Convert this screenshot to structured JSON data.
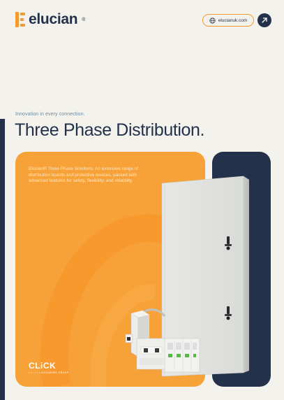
{
  "brand": {
    "name": "elucian",
    "reg": "®",
    "accent_color": "#f29a2e",
    "navy_color": "#23324a"
  },
  "header": {
    "url_label": "elucianuk.com",
    "globe_icon": "globe-icon",
    "arrow_icon": "arrow-up-right-icon"
  },
  "hero": {
    "tagline": "Innovation in every connection.",
    "title": "Three Phase Distribution."
  },
  "card": {
    "description": "Elucian® Three Phase Solutions. An extensive range of distribution boards and protective devices, packed with advanced features for safety, flexibility, and reliability.",
    "partner_logo": "CLiCK",
    "partner_sub": "• • • • • • SCOLMORE GROUP"
  }
}
